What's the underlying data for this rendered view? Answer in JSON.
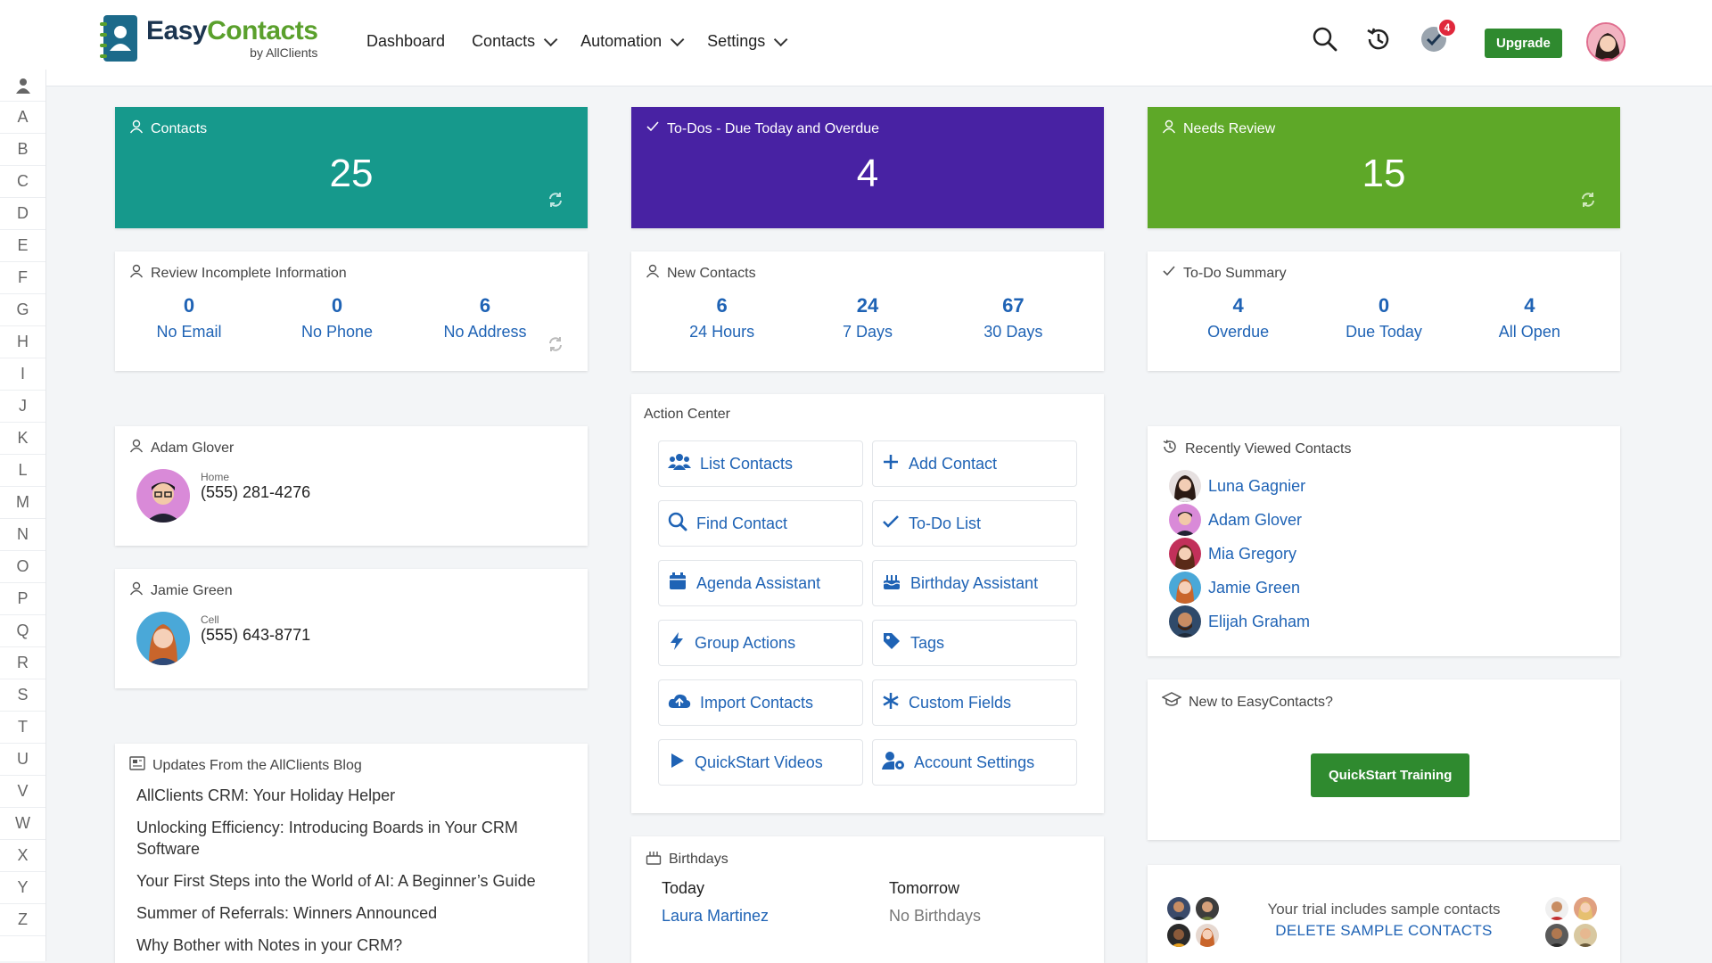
{
  "app": {
    "logo_easy": "Easy",
    "logo_contacts": "Contacts",
    "logo_sub": "by AllClients"
  },
  "nav": {
    "dashboard": "Dashboard",
    "contacts": "Contacts",
    "automation": "Automation",
    "settings": "Settings"
  },
  "header": {
    "notifications_count": "4",
    "upgrade_label": "Upgrade",
    "icons": [
      "search-icon",
      "history-icon",
      "todo-check-icon"
    ]
  },
  "alphabet": [
    "A",
    "B",
    "C",
    "D",
    "E",
    "F",
    "G",
    "H",
    "I",
    "J",
    "K",
    "L",
    "M",
    "N",
    "O",
    "P",
    "Q",
    "R",
    "S",
    "T",
    "U",
    "V",
    "W",
    "X",
    "Y",
    "Z"
  ],
  "colors": {
    "teal": "#16998c",
    "purple": "#4822a3",
    "green": "#5ea828",
    "link": "#1f63b5",
    "button_green": "#2f8a2f"
  },
  "hero": {
    "contacts": {
      "title": "Contacts",
      "value": "25"
    },
    "todos": {
      "title": "To-Dos - Due Today and Overdue",
      "value": "4"
    },
    "review": {
      "title": "Needs Review",
      "value": "15"
    }
  },
  "incomplete": {
    "title": "Review Incomplete Information",
    "stats": [
      {
        "num": "0",
        "label": "No Email"
      },
      {
        "num": "0",
        "label": "No Phone"
      },
      {
        "num": "6",
        "label": "No Address"
      }
    ]
  },
  "new_contacts": {
    "title": "New Contacts",
    "stats": [
      {
        "num": "6",
        "label": "24 Hours"
      },
      {
        "num": "24",
        "label": "7 Days"
      },
      {
        "num": "67",
        "label": "30 Days"
      }
    ]
  },
  "todo_summary": {
    "title": "To-Do Summary",
    "stats": [
      {
        "num": "4",
        "label": "Overdue"
      },
      {
        "num": "0",
        "label": "Due Today"
      },
      {
        "num": "4",
        "label": "All Open"
      }
    ]
  },
  "contact1": {
    "name": "Adam Glover",
    "phone_type": "Home",
    "phone": "(555) 281-4276"
  },
  "contact2": {
    "name": "Jamie Green",
    "phone_type": "Cell",
    "phone": "(555) 643-8771"
  },
  "action_center": {
    "title": "Action Center",
    "buttons": [
      {
        "label": "List Contacts",
        "icon": "users-icon"
      },
      {
        "label": "Add Contact",
        "icon": "plus-icon"
      },
      {
        "label": "Find Contact",
        "icon": "search-icon"
      },
      {
        "label": "To-Do List",
        "icon": "check-icon"
      },
      {
        "label": "Agenda Assistant",
        "icon": "calendar-icon"
      },
      {
        "label": "Birthday Assistant",
        "icon": "cake-icon"
      },
      {
        "label": "Group Actions",
        "icon": "bolt-icon"
      },
      {
        "label": "Tags",
        "icon": "tag-icon"
      },
      {
        "label": "Import Contacts",
        "icon": "cloud-upload-icon"
      },
      {
        "label": "Custom Fields",
        "icon": "asterisk-icon"
      },
      {
        "label": "QuickStart Videos",
        "icon": "play-icon"
      },
      {
        "label": "Account Settings",
        "icon": "user-gear-icon"
      }
    ]
  },
  "recent": {
    "title": "Recently Viewed Contacts",
    "items": [
      "Luna Gagnier",
      "Adam Glover",
      "Mia Gregory",
      "Jamie Green",
      "Elijah Graham"
    ]
  },
  "new_to": {
    "title": "New to EasyContacts?",
    "button": "QuickStart Training"
  },
  "blog": {
    "title": "Updates From the AllClients Blog",
    "items": [
      "AllClients CRM: Your Holiday Helper",
      "Unlocking Efficiency: Introducing Boards in Your CRM Software",
      "Your First Steps into the World of AI: A Beginner’s Guide",
      "Summer of Referrals: Winners Announced",
      "Why Bother with Notes in your CRM?"
    ]
  },
  "birthdays": {
    "title": "Birthdays",
    "today_label": "Today",
    "today_name": "Laura Martinez",
    "tomorrow_label": "Tomorrow",
    "tomorrow_value": "No Birthdays"
  },
  "trial": {
    "text": "Your trial includes sample contacts",
    "link": "DELETE SAMPLE CONTACTS"
  }
}
